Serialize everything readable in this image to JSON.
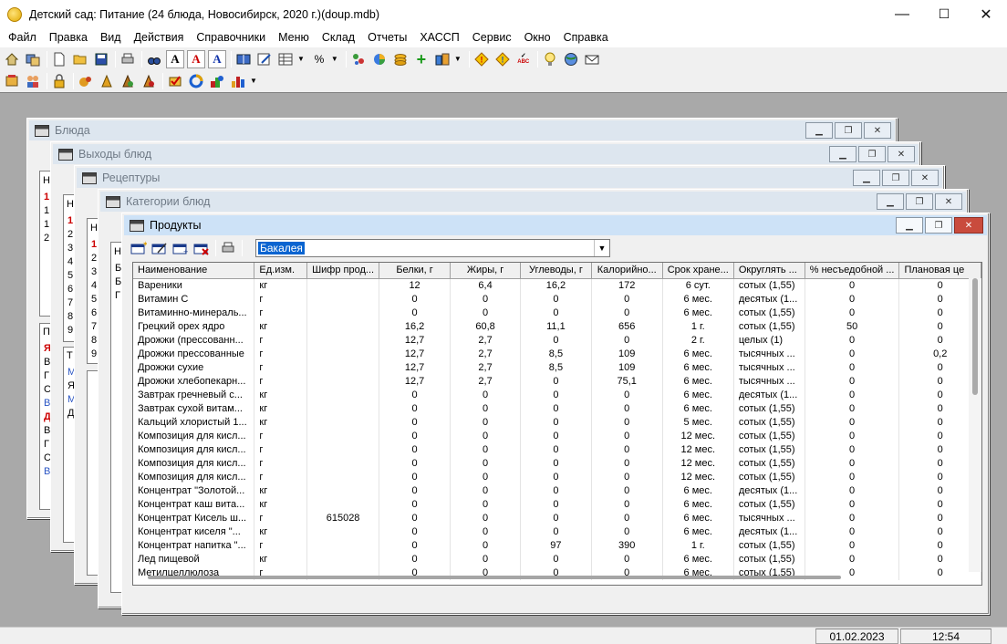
{
  "app": {
    "title": "Детский сад: Питание (24 блюда, Новосибирск, 2020 г.)(doup.mdb)",
    "controls": {
      "minimize": "—",
      "maximize": "☐",
      "close": "✕"
    }
  },
  "menu": [
    "Файл",
    "Правка",
    "Вид",
    "Действия",
    "Справочники",
    "Меню",
    "Склад",
    "Отчеты",
    "ХАССП",
    "Сервис",
    "Окно",
    "Справка"
  ],
  "windows": {
    "bluda": "Блюда",
    "vyhody": "Выходы блюд",
    "receptury": "Рецептуры",
    "kategorii": "Категории блюд",
    "produkty": "Продукты"
  },
  "ghost": {
    "bluda_head": "Н",
    "bluda_rows": [
      "1",
      "1",
      "1",
      "2"
    ],
    "bluda_lower_head": "П",
    "bluda_lower_rows": [
      "Я",
      "В",
      "Г",
      "С",
      "В",
      "Д",
      "В",
      "Г",
      "С",
      "В"
    ],
    "vyhody_head": "Н",
    "vyhody_rows": [
      "1",
      "2",
      "3",
      "4",
      "5",
      "6",
      "7",
      "8",
      "9"
    ],
    "vyhody_lower_head": "Т",
    "vyhody_lower_rows": [
      "М",
      "Я",
      "М",
      "Д"
    ],
    "rec_head": "Н",
    "rec_rows": [
      "1",
      "2",
      "3",
      "4",
      "5",
      "6",
      "7",
      "8",
      "9"
    ],
    "kat_head": "Н",
    "kat_rows": [
      "Б",
      "Б",
      "Г"
    ]
  },
  "products": {
    "category": "Бакалея",
    "columns": [
      "Наименование",
      "Ед.изм.",
      "Шифр прод...",
      "Белки, г",
      "Жиры, г",
      "Углеводы, г",
      "Калорийно...",
      "Срок хране...",
      "Округлять ...",
      "% несъедобной ...",
      "Плановая це"
    ],
    "rows": [
      [
        "Вареники",
        "кг",
        "",
        "12",
        "6,4",
        "16,2",
        "172",
        "6 сут.",
        "сотых (1,55)",
        "0",
        "0"
      ],
      [
        "Витамин С",
        "г",
        "",
        "0",
        "0",
        "0",
        "0",
        "6 мес.",
        "десятых (1...",
        "0",
        "0"
      ],
      [
        "Витаминно-минераль...",
        "г",
        "",
        "0",
        "0",
        "0",
        "0",
        "6 мес.",
        "сотых (1,55)",
        "0",
        "0"
      ],
      [
        "Грецкий орех ядро",
        "кг",
        "",
        "16,2",
        "60,8",
        "11,1",
        "656",
        "1 г.",
        "сотых (1,55)",
        "50",
        "0"
      ],
      [
        "Дрожжи (прессованн...",
        "г",
        "",
        "12,7",
        "2,7",
        "0",
        "0",
        "2 г.",
        "целых (1)",
        "0",
        "0"
      ],
      [
        "Дрожжи прессованные",
        "г",
        "",
        "12,7",
        "2,7",
        "8,5",
        "109",
        "6 мес.",
        "тысячных ...",
        "0",
        "0,2"
      ],
      [
        "Дрожжи сухие",
        "г",
        "",
        "12,7",
        "2,7",
        "8,5",
        "109",
        "6 мес.",
        "тысячных ...",
        "0",
        "0"
      ],
      [
        "Дрожжи хлебопекарн...",
        "г",
        "",
        "12,7",
        "2,7",
        "0",
        "75,1",
        "6 мес.",
        "тысячных ...",
        "0",
        "0"
      ],
      [
        "Завтрак гречневый с...",
        "кг",
        "",
        "0",
        "0",
        "0",
        "0",
        "6 мес.",
        "десятых (1...",
        "0",
        "0"
      ],
      [
        "Завтрак сухой витам...",
        "кг",
        "",
        "0",
        "0",
        "0",
        "0",
        "6 мес.",
        "сотых (1,55)",
        "0",
        "0"
      ],
      [
        "Кальций хлористый 1...",
        "кг",
        "",
        "0",
        "0",
        "0",
        "0",
        "5 мес.",
        "сотых (1,55)",
        "0",
        "0"
      ],
      [
        "Композиция для кисл...",
        "г",
        "",
        "0",
        "0",
        "0",
        "0",
        "12 мес.",
        "сотых (1,55)",
        "0",
        "0"
      ],
      [
        "Композиция для кисл...",
        "г",
        "",
        "0",
        "0",
        "0",
        "0",
        "12 мес.",
        "сотых (1,55)",
        "0",
        "0"
      ],
      [
        "Композиция для кисл...",
        "г",
        "",
        "0",
        "0",
        "0",
        "0",
        "12 мес.",
        "сотых (1,55)",
        "0",
        "0"
      ],
      [
        "Композиция для кисл...",
        "г",
        "",
        "0",
        "0",
        "0",
        "0",
        "12 мес.",
        "сотых (1,55)",
        "0",
        "0"
      ],
      [
        "Концентрат \"Золотой...",
        "кг",
        "",
        "0",
        "0",
        "0",
        "0",
        "6 мес.",
        "десятых (1...",
        "0",
        "0"
      ],
      [
        "Концентрат каш вита...",
        "кг",
        "",
        "0",
        "0",
        "0",
        "0",
        "6 мес.",
        "сотых (1,55)",
        "0",
        "0"
      ],
      [
        "Концентрат Кисель ш...",
        "г",
        "615028",
        "0",
        "0",
        "0",
        "0",
        "6 мес.",
        "тысячных ...",
        "0",
        "0"
      ],
      [
        "Концентрат киселя \"...",
        "кг",
        "",
        "0",
        "0",
        "0",
        "0",
        "6 мес.",
        "десятых (1...",
        "0",
        "0"
      ],
      [
        "Концентрат напитка \"...",
        "г",
        "",
        "0",
        "0",
        "97",
        "390",
        "1 г.",
        "сотых (1,55)",
        "0",
        "0"
      ],
      [
        "Лед пищевой",
        "кг",
        "",
        "0",
        "0",
        "0",
        "0",
        "6 мес.",
        "сотых (1,55)",
        "0",
        "0"
      ],
      [
        "Метилцеллюлоза",
        "г",
        "",
        "0",
        "0",
        "0",
        "0",
        "6 мес.",
        "сотых (1,55)",
        "0",
        "0"
      ]
    ]
  },
  "status": {
    "date": "01.02.2023",
    "time": "12:54"
  },
  "icons": {
    "toolbar1": [
      "home-icon",
      "switch-icon",
      "new-file-icon",
      "open-folder-icon",
      "save-icon",
      "print-icon",
      "binoculars-icon",
      "font-a-icon",
      "font-a-red-icon",
      "font-a-blue-icon",
      "book-icon",
      "edit-icon",
      "table-icon",
      "percent-icon",
      "tools-icon",
      "pie-chart-icon",
      "coins-icon",
      "add-icon",
      "boxes-icon",
      "warning-icon",
      "warning-abc-icon",
      "spellcheck-icon",
      "lightbulb-icon",
      "globe-icon",
      "mail-icon"
    ],
    "toolbar2": [
      "dish-icon",
      "users-icon",
      "lock-icon",
      "ingredients-icon",
      "ingredients2-icon",
      "ingredients3-icon",
      "ingredients4-icon",
      "checklist-icon",
      "cycle-icon",
      "mixed-icon",
      "bar-chart-icon"
    ]
  }
}
